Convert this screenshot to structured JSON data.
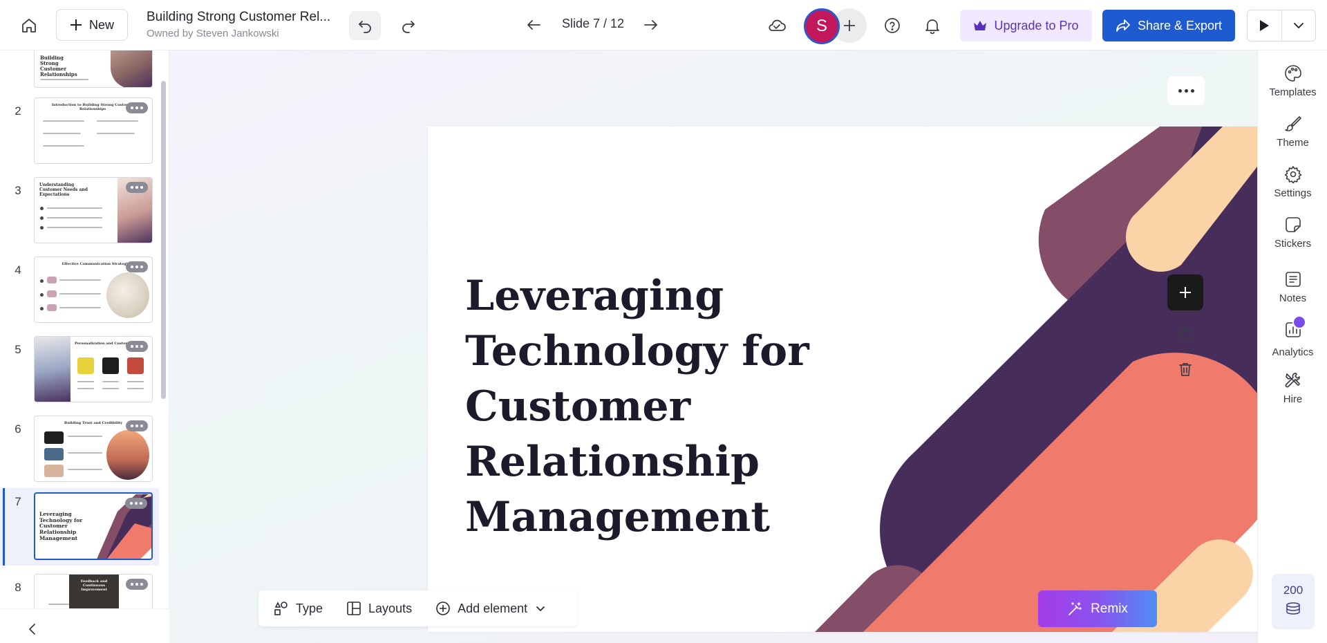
{
  "header": {
    "new_label": "New",
    "doc_title": "Building Strong Customer Rel...",
    "doc_owner": "Owned by Steven Jankowski",
    "slide_counter": "Slide 7 / 12",
    "avatar_initial": "S",
    "upgrade_label": "Upgrade to Pro",
    "share_label": "Share & Export"
  },
  "slides_panel": {
    "thumbnails": [
      {
        "number": "",
        "title": "Building Strong Customer Relationships"
      },
      {
        "number": "2",
        "title": "Introduction to Building Strong Customer Relationships"
      },
      {
        "number": "3",
        "title": "Understanding Customer Needs and Expectations"
      },
      {
        "number": "4",
        "title": "Effective Communication Strategies"
      },
      {
        "number": "5",
        "title": "Personalization and Customization"
      },
      {
        "number": "6",
        "title": "Building Trust and Credibility"
      },
      {
        "number": "7",
        "title": "Leveraging Technology for Customer Relationship Management"
      },
      {
        "number": "8",
        "title": "Feedback and Continuous Improvement"
      }
    ],
    "active_index": 6
  },
  "slide": {
    "title": "Leveraging Technology for Customer Relationship Management",
    "colors": {
      "plum": "#844d68",
      "dark_purple": "#472d59",
      "coral": "#f07b6c",
      "peach": "#fad3a7"
    }
  },
  "bottom_toolbar": {
    "type_label": "Type",
    "layouts_label": "Layouts",
    "add_element_label": "Add element",
    "remix_label": "Remix"
  },
  "right_sidebar": {
    "items": [
      {
        "label": "Templates",
        "icon": "palette-icon"
      },
      {
        "label": "Theme",
        "icon": "brush-icon"
      },
      {
        "label": "Settings",
        "icon": "gear-icon"
      },
      {
        "label": "Stickers",
        "icon": "sticker-icon"
      },
      {
        "label": "Notes",
        "icon": "notes-icon"
      },
      {
        "label": "Analytics",
        "icon": "chart-icon"
      },
      {
        "label": "Hire",
        "icon": "tools-icon"
      }
    ],
    "credits": "200"
  },
  "accent_colors": {
    "primary": "#1e5bd1",
    "upgrade_bg": "#f1e9ff",
    "upgrade_text": "#5b2fc0",
    "avatar": "#c2185b"
  }
}
